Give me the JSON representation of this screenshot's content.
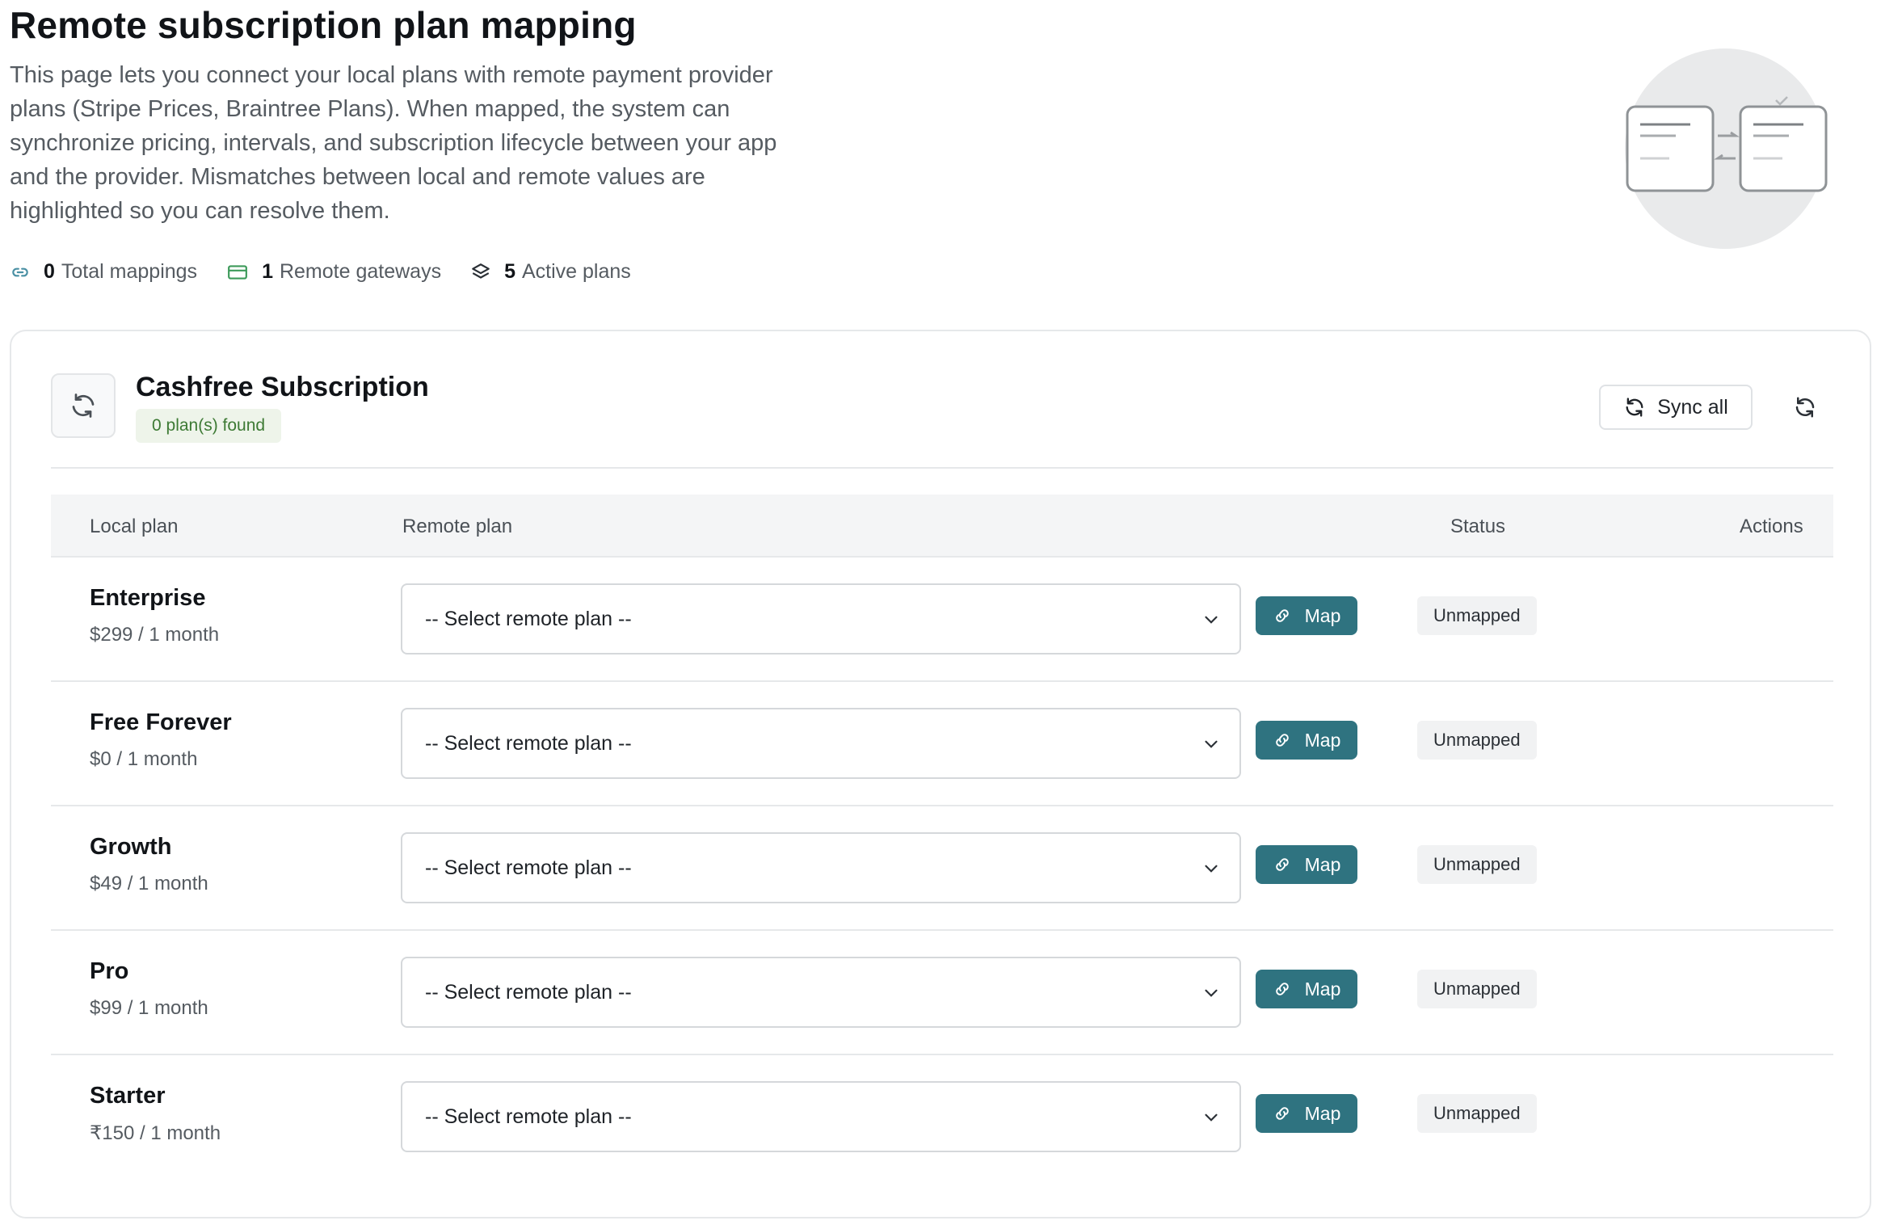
{
  "header": {
    "title": "Remote subscription plan mapping",
    "description": "This page lets you connect your local plans with remote payment provider plans (Stripe Prices, Braintree Plans). When mapped, the system can synchronize pricing, intervals, and subscription lifecycle between your app and the provider. Mismatches between local and remote values are highlighted so you can resolve them."
  },
  "stats": [
    {
      "icon": "link-icon",
      "count": "0",
      "label": "Total mappings"
    },
    {
      "icon": "credit-card-icon",
      "count": "1",
      "label": "Remote gateways"
    },
    {
      "icon": "layers-icon",
      "count": "5",
      "label": "Active plans"
    }
  ],
  "gateway": {
    "icon": "sync-icon",
    "name": "Cashfree Subscription",
    "badge": "0 plan(s) found",
    "sync_all_label": "Sync all",
    "refresh_icon": "refresh-icon"
  },
  "table": {
    "headers": {
      "local": "Local plan",
      "remote": "Remote plan",
      "status": "Status",
      "actions": "Actions"
    },
    "rows": [
      {
        "name": "Enterprise",
        "price": "$299 / 1 month",
        "select": "-- Select remote plan --",
        "map_label": "Map",
        "status": "Unmapped"
      },
      {
        "name": "Free Forever",
        "price": "$0 / 1 month",
        "select": "-- Select remote plan --",
        "map_label": "Map",
        "status": "Unmapped"
      },
      {
        "name": "Growth",
        "price": "$49 / 1 month",
        "select": "-- Select remote plan --",
        "map_label": "Map",
        "status": "Unmapped"
      },
      {
        "name": "Pro",
        "price": "$99 / 1 month",
        "select": "-- Select remote plan --",
        "map_label": "Map",
        "status": "Unmapped"
      },
      {
        "name": "Starter",
        "price": "₹150 / 1 month",
        "select": "-- Select remote plan --",
        "map_label": "Map",
        "status": "Unmapped"
      }
    ]
  },
  "colors": {
    "primary": "#2f7380",
    "badge_green_bg": "#eef4ea",
    "badge_green_text": "#3d7a34",
    "status_bg": "#f1f2f3"
  }
}
